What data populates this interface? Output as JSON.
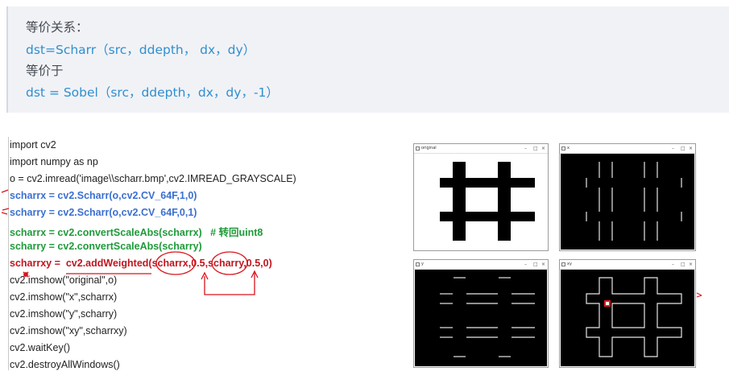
{
  "note": {
    "line1": "等价关系：",
    "line2": "dst=Scharr（src，ddepth， dx，dy）",
    "line3": "等价于",
    "line4": "dst = Sobel（src，ddepth，dx，dy，-1）"
  },
  "code": {
    "lines": [
      "import cv2",
      "import numpy as np",
      "o = cv2.imread('image\\\\scharr.bmp',cv2.IMREAD_GRAYSCALE)",
      "scharrx = cv2.Scharr(o,cv2.CV_64F,1,0)",
      "scharry = cv2.Scharr(o,cv2.CV_64F,0,1)",
      "scharrx = cv2.convertScaleAbs(scharrx)   # 转回uint8",
      "scharry = cv2.convertScaleAbs(scharry)",
      "scharrxy =  cv2.addWeighted(scharrx,0.5,scharry,0.5,0)",
      "cv2.imshow(\"original\",o)",
      "cv2.imshow(\"x\",scharrx)",
      "cv2.imshow(\"y\",scharry)",
      "cv2.imshow(\"xy\",scharrxy)",
      "cv2.waitKey()",
      "cv2.destroyAllWindows()"
    ]
  },
  "windows": {
    "original": {
      "title": "original"
    },
    "x": {
      "title": "x"
    },
    "y": {
      "title": "y"
    },
    "xy": {
      "title": "xy"
    },
    "controls": {
      "minimize": "–",
      "maximize": "□",
      "close": "×"
    }
  },
  "colors": {
    "note_bg": "#f1f2f6",
    "code_blue": "#3b6fd0",
    "code_green": "#1f9a3a",
    "code_red": "#c0151f",
    "annotation_red": "#d9141b"
  }
}
